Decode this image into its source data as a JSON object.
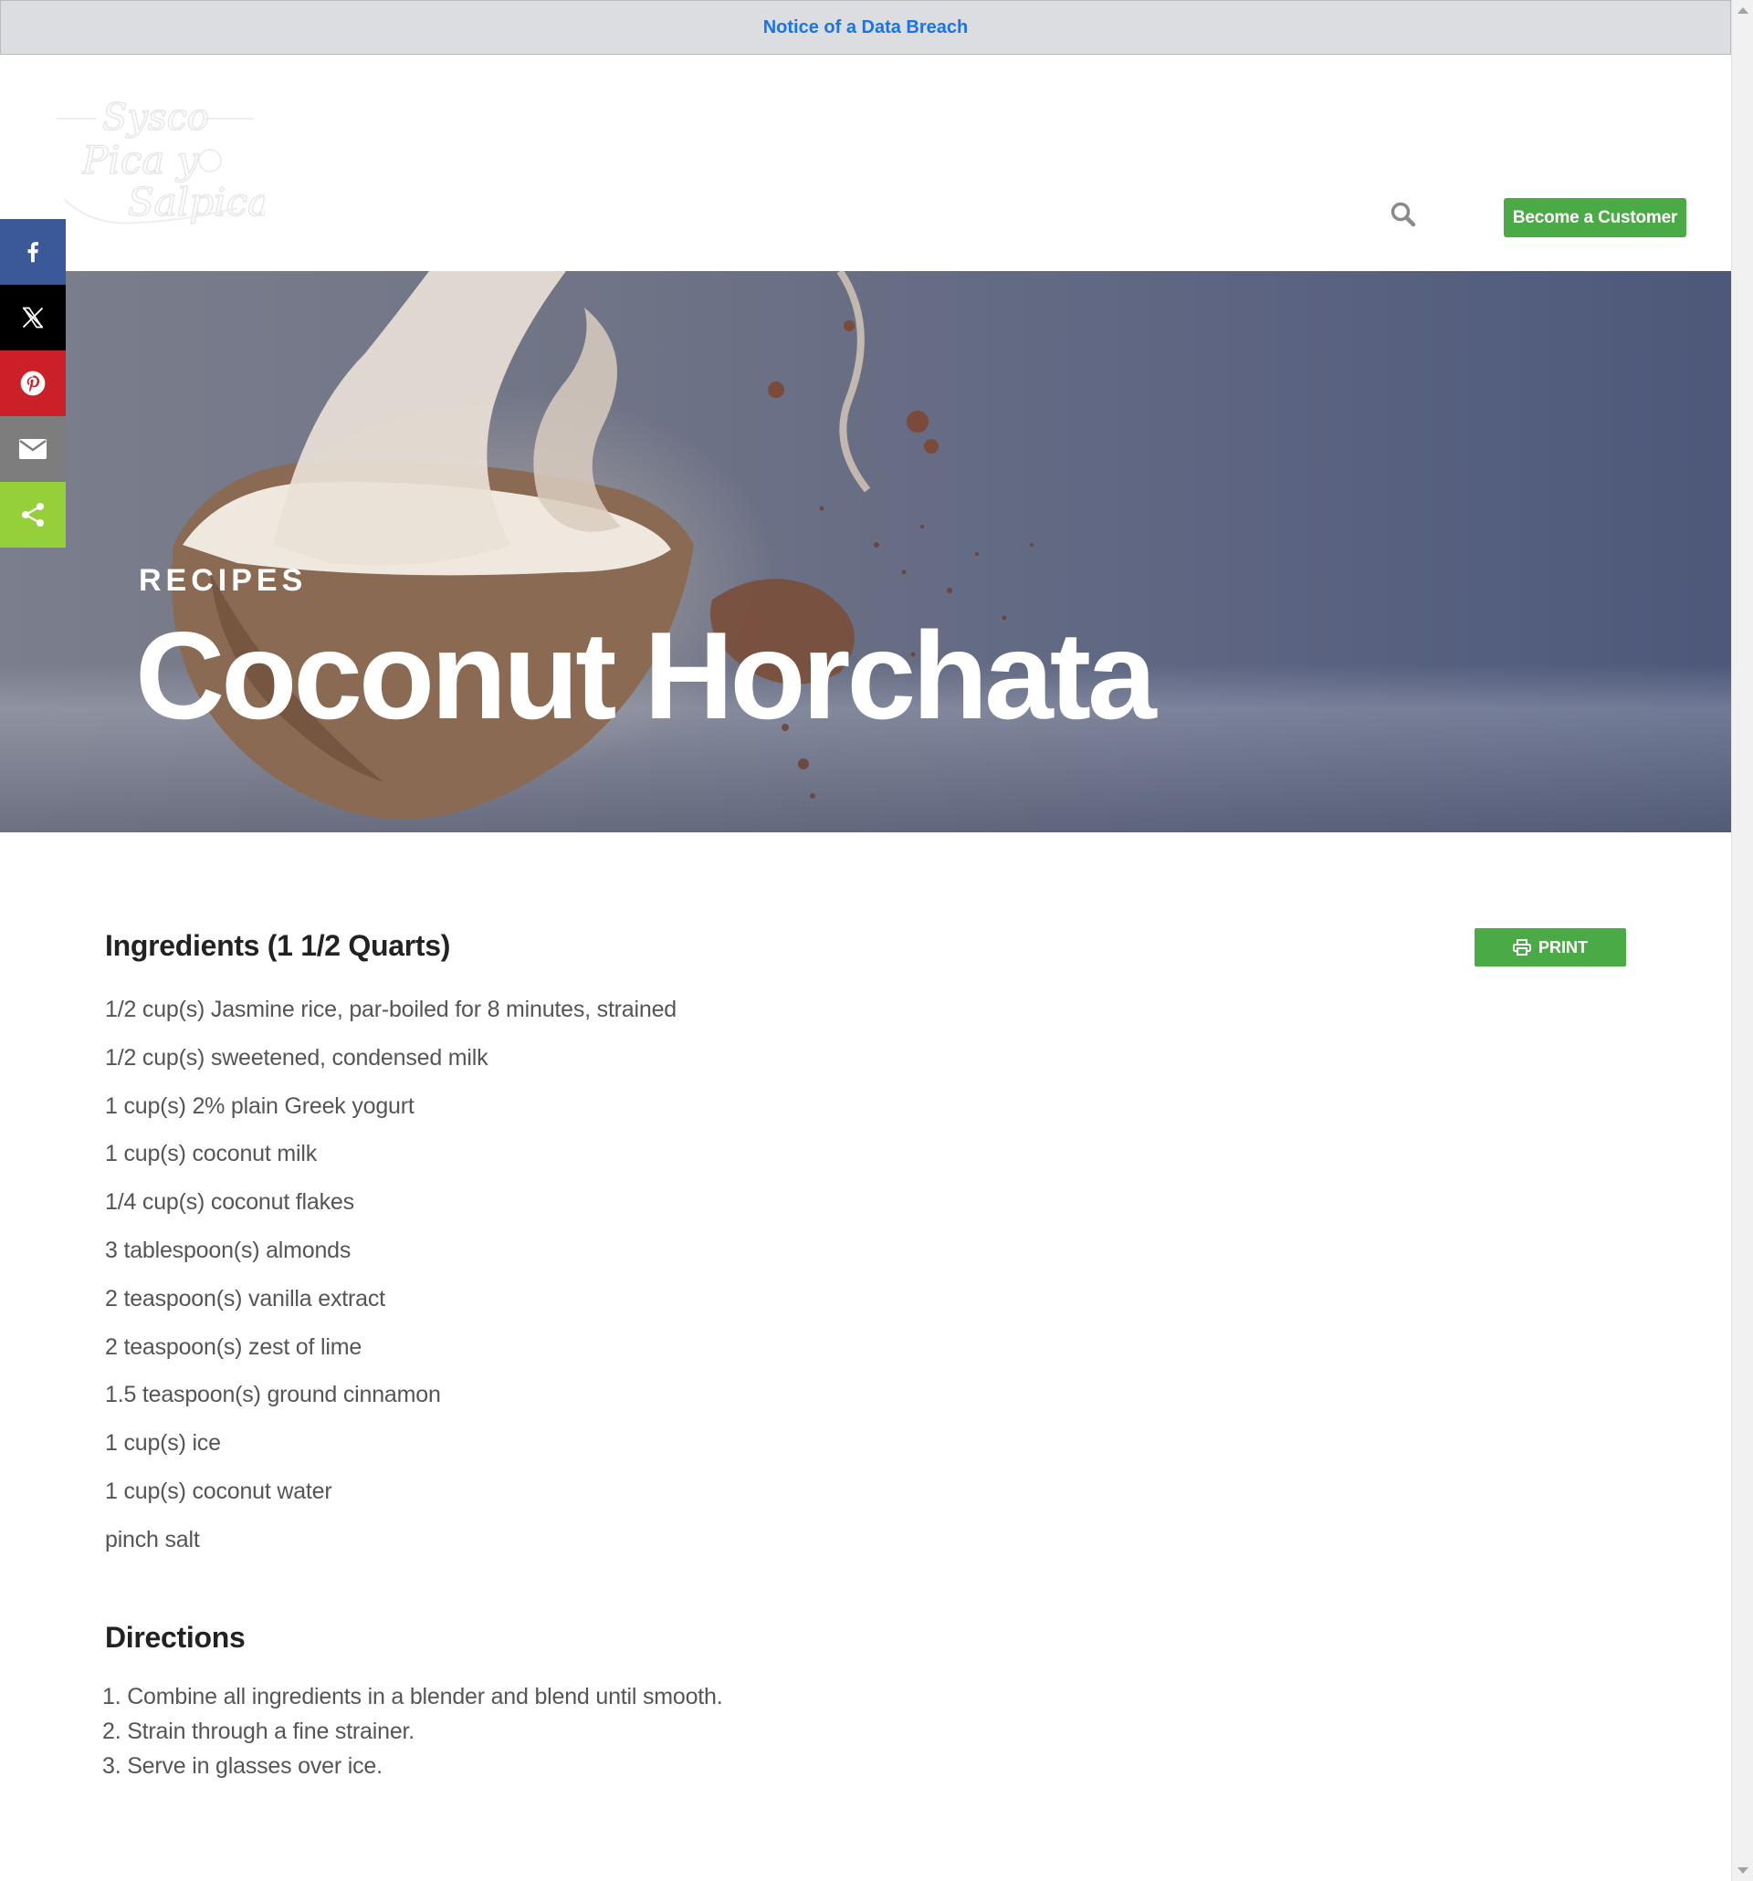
{
  "notice": {
    "link_text": "Notice of a Data Breach"
  },
  "header": {
    "logo": {
      "line1": "Sysco",
      "line2": "Pica y",
      "line3": "Salpica"
    },
    "search_icon": "search-icon",
    "cta_label": "Become a Customer"
  },
  "social": [
    {
      "name": "facebook",
      "icon": "facebook-icon",
      "color": "#3b5998"
    },
    {
      "name": "x",
      "icon": "x-icon",
      "color": "#000000"
    },
    {
      "name": "pinterest",
      "icon": "pinterest-icon",
      "color": "#cb2027"
    },
    {
      "name": "email",
      "icon": "email-icon",
      "color": "#7d7d7d"
    },
    {
      "name": "share",
      "icon": "share-icon",
      "color": "#95d03a"
    }
  ],
  "hero": {
    "eyebrow": "RECIPES",
    "title": "Coconut Horchata"
  },
  "recipe": {
    "ingredients_heading": "Ingredients (1 1/2 Quarts)",
    "print_label": "PRINT",
    "ingredients": [
      "1/2 cup(s) Jasmine rice, par-boiled for 8 minutes, strained",
      "1/2 cup(s) sweetened, condensed milk",
      "1 cup(s) 2% plain Greek yogurt",
      "1 cup(s) coconut milk",
      "1/4 cup(s) coconut flakes",
      "3 tablespoon(s) almonds",
      "2 teaspoon(s) vanilla extract",
      "2 teaspoon(s) zest of lime",
      "1.5 teaspoon(s) ground cinnamon",
      "1 cup(s) ice",
      "1 cup(s) coconut water",
      "pinch salt"
    ],
    "directions_heading": "Directions",
    "directions": [
      "1. Combine all ingredients in a blender and blend until smooth.",
      "2. Strain through a fine strainer.",
      "3. Serve in glasses over ice."
    ]
  },
  "colors": {
    "accent_green": "#4aab46",
    "notice_link": "#1a73e8",
    "notice_bg": "#dcdde0"
  }
}
